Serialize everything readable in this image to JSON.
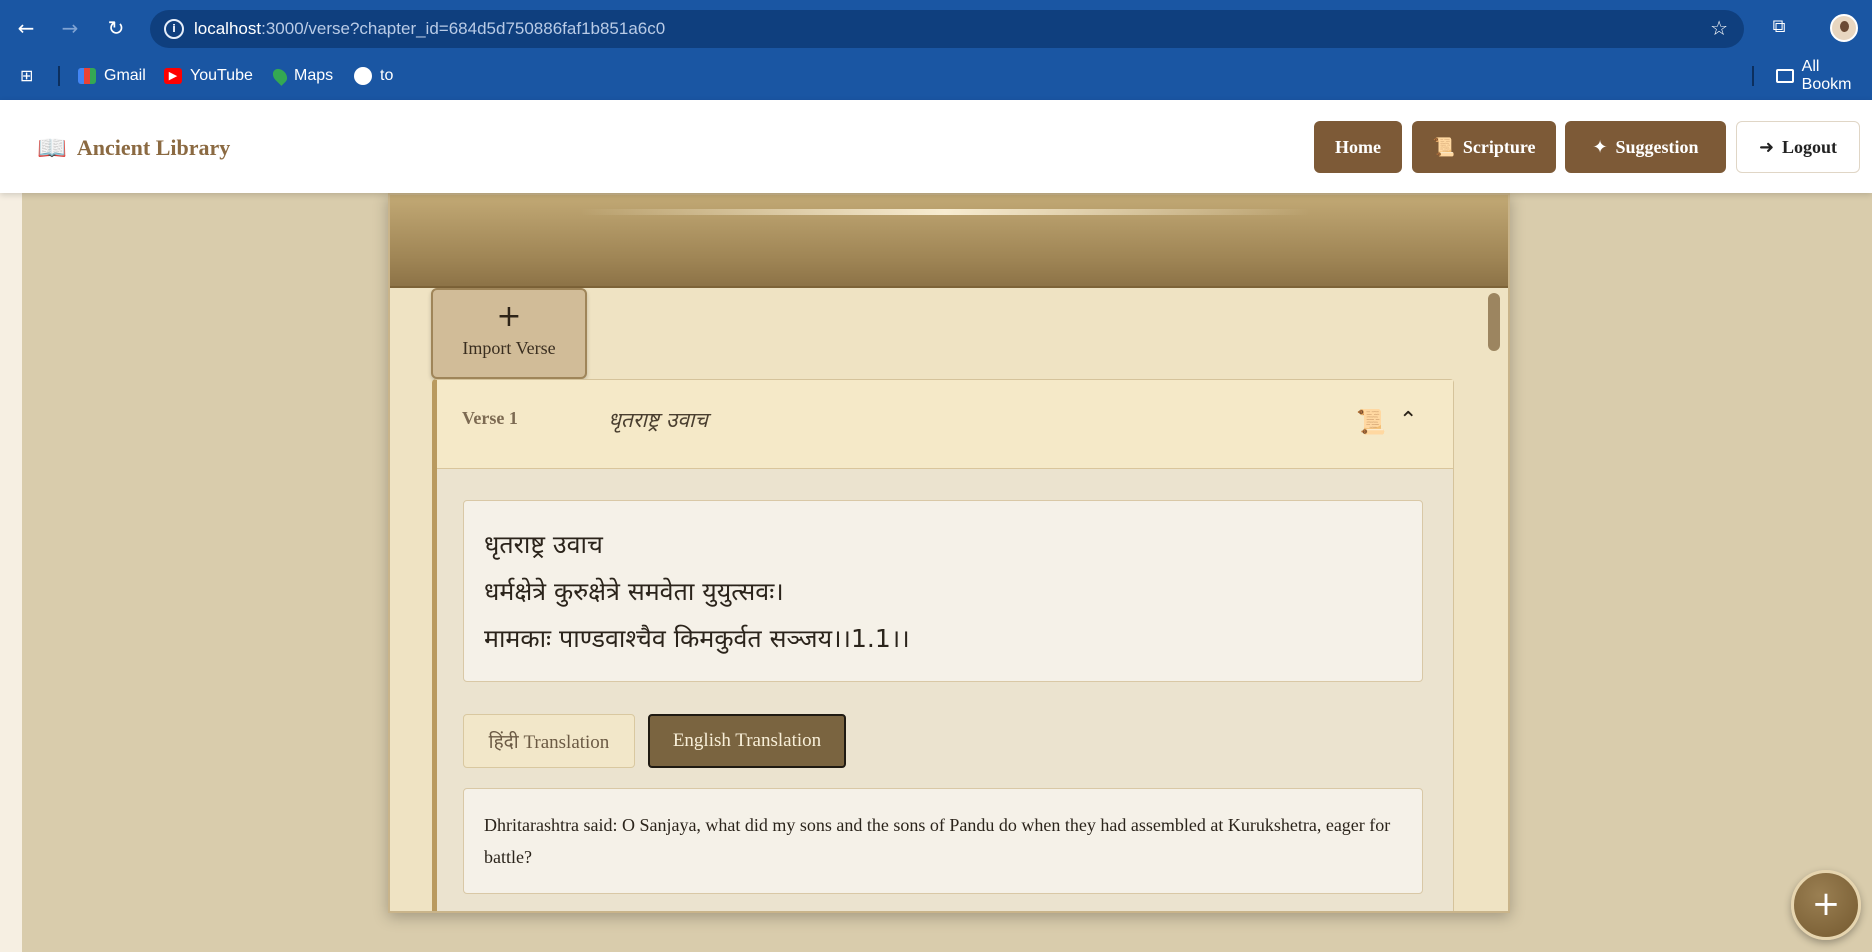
{
  "browser": {
    "url_host": "localhost",
    "url_rest": ":3000/verse?chapter_id=684d5d750886faf1b851a6c0",
    "back_icon": "←",
    "forward_icon": "→",
    "reload_icon": "↻",
    "info_icon": "i",
    "star_icon": "☆",
    "bookmarks": [
      {
        "label": "Gmail"
      },
      {
        "label": "YouTube"
      },
      {
        "label": "Maps"
      },
      {
        "label": "to"
      }
    ],
    "all_bookmarks_label": "All Bookm"
  },
  "header": {
    "brand": "Ancient Library",
    "nav": [
      {
        "label": "Home"
      },
      {
        "label": "Scripture",
        "icon": "scroll-icon"
      },
      {
        "label": "Suggestion",
        "icon": "sparkles-icon"
      },
      {
        "label": "Logout",
        "icon": "sign-in-icon"
      }
    ]
  },
  "main": {
    "import_label": "Import Verse",
    "verse": {
      "number_label": "Verse 1",
      "title": "धृतराष्ट्र उवाच",
      "sanskrit_lines": [
        "धृतराष्ट्र उवाच",
        "धर्मक्षेत्रे कुरुक्षेत्रे समवेता युयुत्सवः।",
        "मामकाः पाण्डवाश्चैव किमकुर्वत सञ्जय।।1.1।।"
      ],
      "translation_tabs": [
        {
          "label": "हिंदी Translation",
          "active": false
        },
        {
          "label": "English Translation",
          "active": true
        }
      ],
      "translation_text": "Dhritarashtra said: O Sanjaya, what did my sons and the sons of Pandu do when they had assembled at Kurukshetra, eager for battle?"
    }
  },
  "fab": {
    "icon": "+"
  },
  "colors": {
    "brand_brown": "#7d5a37",
    "browser_blue": "#1a56a3",
    "parchment": "#efe3c3"
  }
}
